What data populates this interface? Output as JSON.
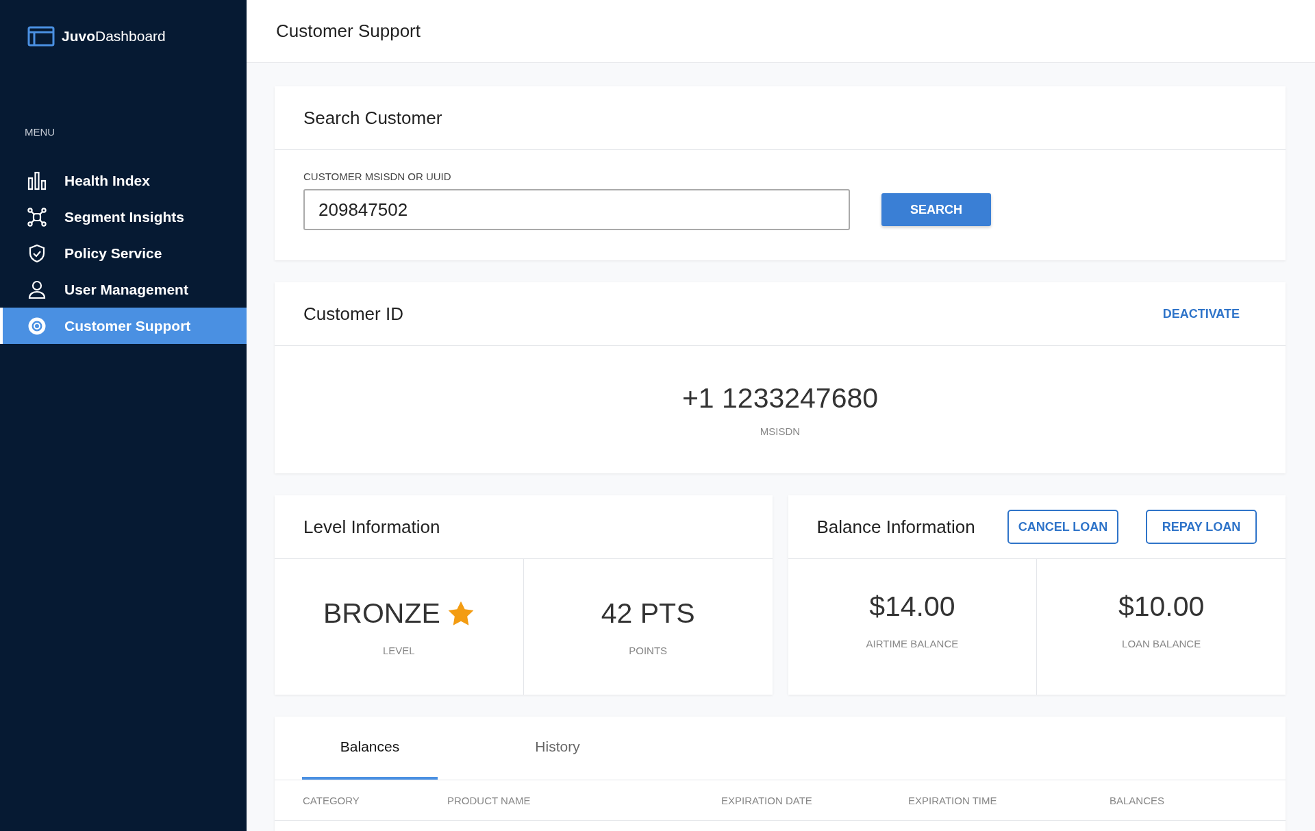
{
  "sidebar": {
    "logo": "**Juvo**Dashboard",
    "menu_label": "MENU",
    "items": [
      {
        "label": "Health Index",
        "kind": "chart",
        "selected": false
      },
      {
        "label": "Segment Insights",
        "kind": "network",
        "selected": false
      },
      {
        "label": "Policy Service",
        "kind": "shield",
        "selected": false
      },
      {
        "label": "User Management",
        "kind": "user",
        "selected": false
      },
      {
        "label": "Customer Support",
        "kind": "lifebuoy",
        "selected": true
      }
    ]
  },
  "header": {
    "title": "Customer Support"
  },
  "search": {
    "title": "Search Customer",
    "field_label": "CUSTOMER MSISDN OR UUID",
    "value": "209847502",
    "button": "SEARCH"
  },
  "customer": {
    "title": "Customer ID",
    "action": "DEACTIVATE",
    "msisdn": "+1 1233247680",
    "msisdn_label": "MSISDN"
  },
  "level": {
    "title": "Level Information",
    "stats": [
      {
        "value": "BRONZE",
        "label": "LEVEL",
        "starred": true
      },
      {
        "value": "42 PTS",
        "label": "POINTS",
        "starred": false
      }
    ]
  },
  "balance": {
    "title": "Balance Information",
    "buttons": [
      "CANCEL LOAN",
      "REPAY LOAN"
    ],
    "stats": [
      {
        "value": "$14.00",
        "label": "AIRTIME BALANCE"
      },
      {
        "value": "$10.00",
        "label": "LOAN BALANCE"
      }
    ]
  },
  "tabs": [
    {
      "label": "Balances",
      "selected": true
    },
    {
      "label": "History",
      "selected": false
    }
  ],
  "table": {
    "columns": [
      "CATEGORY",
      "PRODUCT NAME",
      "EXPIRATION DATE",
      "EXPIRATION TIME",
      "BALANCES"
    ]
  }
}
